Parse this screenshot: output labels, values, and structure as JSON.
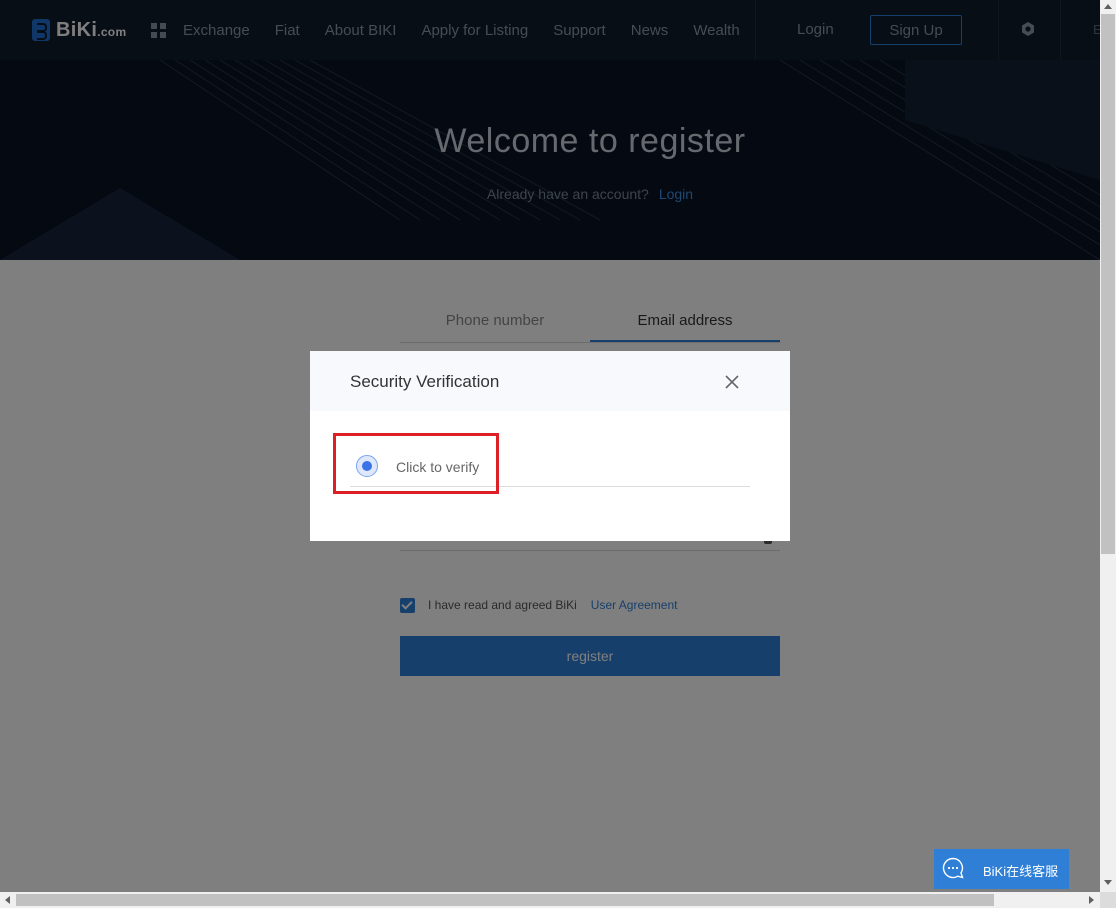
{
  "header": {
    "logo_text": "BiKi",
    "logo_suffix": ".com",
    "nav": [
      "Exchange",
      "Fiat",
      "About BIKI",
      "Apply for Listing",
      "Support",
      "News",
      "Wealth"
    ],
    "login_label": "Login",
    "signup_label": "Sign Up",
    "lang_partial": "E"
  },
  "hero": {
    "title": "Welcome to register",
    "subtitle": "Already have an account?",
    "login_link": "Login"
  },
  "form": {
    "tabs": [
      {
        "label": "Phone number",
        "active": false
      },
      {
        "label": "Email address",
        "active": true
      }
    ],
    "agree_text": "I have read and agreed BiKi",
    "agree_link": "User Agreement",
    "agree_checked": true,
    "register_label": "register"
  },
  "modal": {
    "title": "Security Verification",
    "verify_label": "Click to verify"
  },
  "chat": {
    "label": "BiKi在线客服"
  },
  "colors": {
    "accent": "#2f7fd6",
    "header_bg": "#0f1c2c",
    "highlight": "#dd1f26"
  }
}
